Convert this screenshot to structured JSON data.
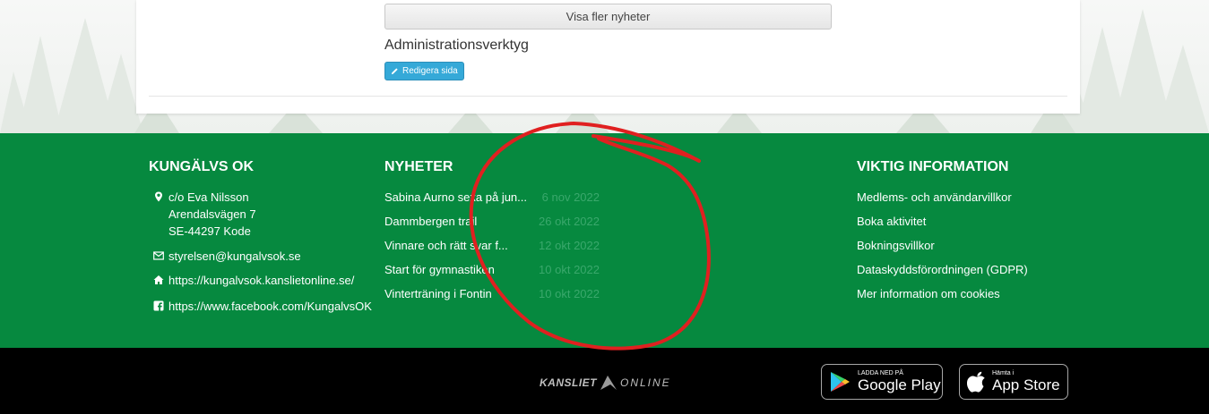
{
  "content": {
    "more_news_label": "Visa fler nyheter",
    "admin_title": "Administrationsverktyg",
    "edit_page_label": "Redigera sida"
  },
  "footer": {
    "club": {
      "title": "KUNGÄLVS OK",
      "address": [
        "c/o Eva Nilsson",
        "Arendalsvägen 7",
        "SE-44297 Kode"
      ],
      "email": "styrelsen@kungalvsok.se",
      "website": "https://kungalvsok.kanslietonline.se/",
      "facebook": "https://www.facebook.com/KungalvsOK"
    },
    "news": {
      "title": "NYHETER",
      "items": [
        {
          "title": "Sabina Aurno sexa på jun...",
          "date": "6 nov 2022"
        },
        {
          "title": "Dammbergen trail",
          "date": "26 okt 2022"
        },
        {
          "title": "Vinnare och rätt svar f...",
          "date": "12 okt 2022"
        },
        {
          "title": "Start för gymnastiken",
          "date": "10 okt 2022"
        },
        {
          "title": "Vinterträning i Fontin",
          "date": "10 okt 2022"
        }
      ]
    },
    "info": {
      "title": "VIKTIG INFORMATION",
      "links": [
        "Medlems- och användarvillkor",
        "Boka aktivitet",
        "Bokningsvillkor",
        "Dataskyddsförordningen (GDPR)",
        "Mer information om cookies"
      ]
    }
  },
  "bottom": {
    "logo_part1": "KANSLIET",
    "logo_part2": "ONLINE",
    "google_play": {
      "small": "LADDA NED PÅ",
      "big": "Google Play"
    },
    "app_store": {
      "small": "Hämta i",
      "big": "App Store"
    }
  },
  "colors": {
    "footer_green": "#06893f",
    "accent_blue": "#35a9d8",
    "annotation_red": "#e02020"
  }
}
